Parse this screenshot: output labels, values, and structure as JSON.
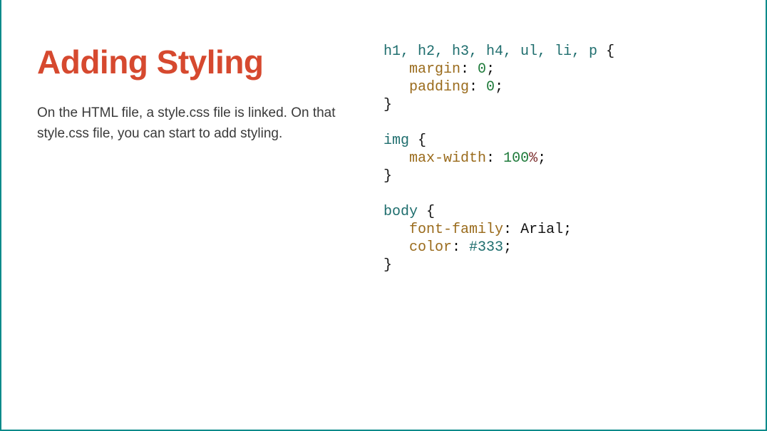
{
  "slide": {
    "heading": "Adding Styling",
    "description": "On the HTML file, a style.css file is linked. On that style.css file, you can start to add styling."
  },
  "code": {
    "block1": {
      "selector": "h1, h2, h3, h4, ul, li, p",
      "open": " {",
      "line1_prop": "margin",
      "line1_val": "0",
      "line2_prop": "padding",
      "line2_val": "0",
      "close": "}"
    },
    "block2": {
      "selector": "img",
      "open": " {",
      "line1_prop": "max-width",
      "line1_val_num": "100",
      "line1_val_unit": "%",
      "close": "}"
    },
    "block3": {
      "selector": "body",
      "open": " {",
      "line1_prop": "font-family",
      "line1_val": "Arial",
      "line2_prop": "color",
      "line2_val": "#333",
      "close": "}"
    },
    "indent": "   ",
    "colon_sp": ": ",
    "semi": ";"
  }
}
